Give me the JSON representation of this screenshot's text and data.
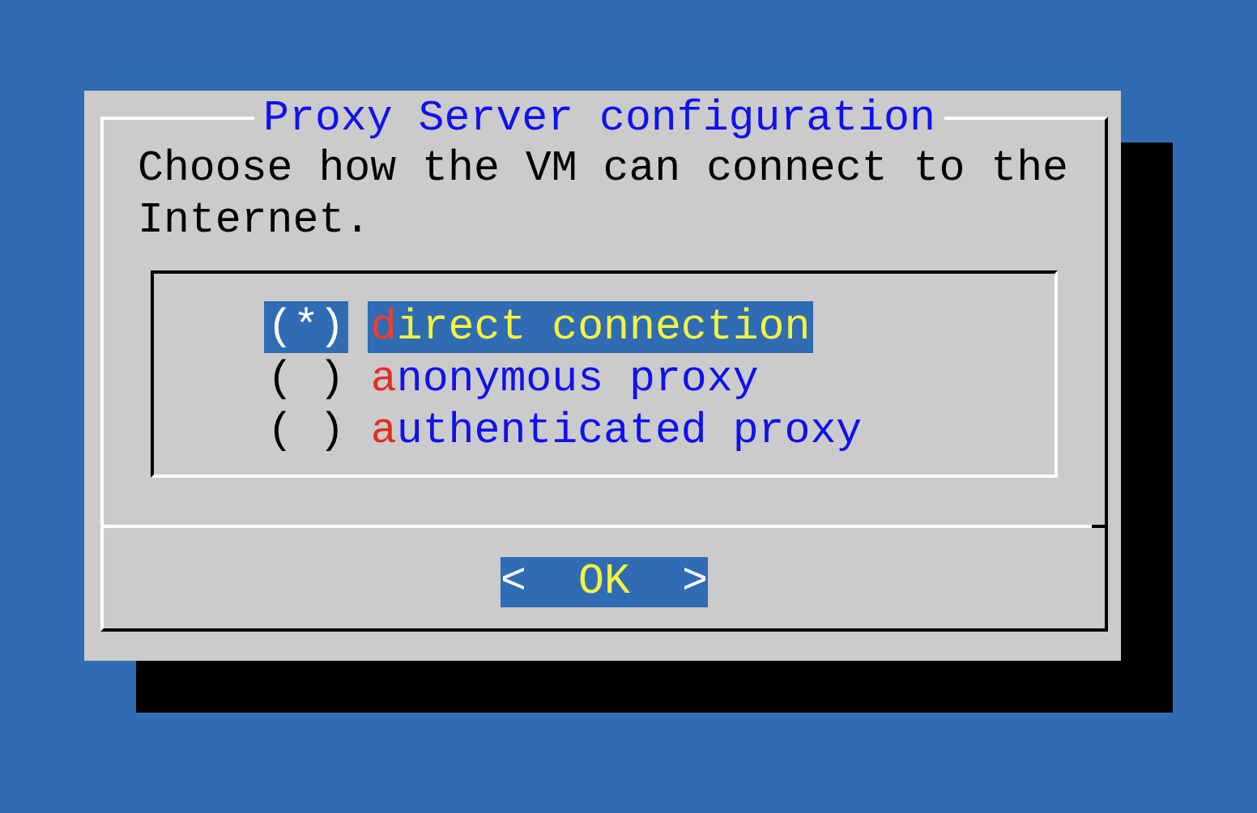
{
  "dialog": {
    "title": "Proxy Server configuration",
    "message": "Choose how the VM can connect to the Internet.",
    "options": [
      {
        "marker": "(*)",
        "label": "direct connection",
        "selected": true
      },
      {
        "marker": "( )",
        "label": "anonymous proxy",
        "selected": false
      },
      {
        "marker": "( )",
        "label": "authenticated proxy",
        "selected": false
      }
    ],
    "buttons": [
      {
        "left_mark": "<",
        "label": "OK",
        "right_mark": ">",
        "selected": true
      }
    ]
  }
}
